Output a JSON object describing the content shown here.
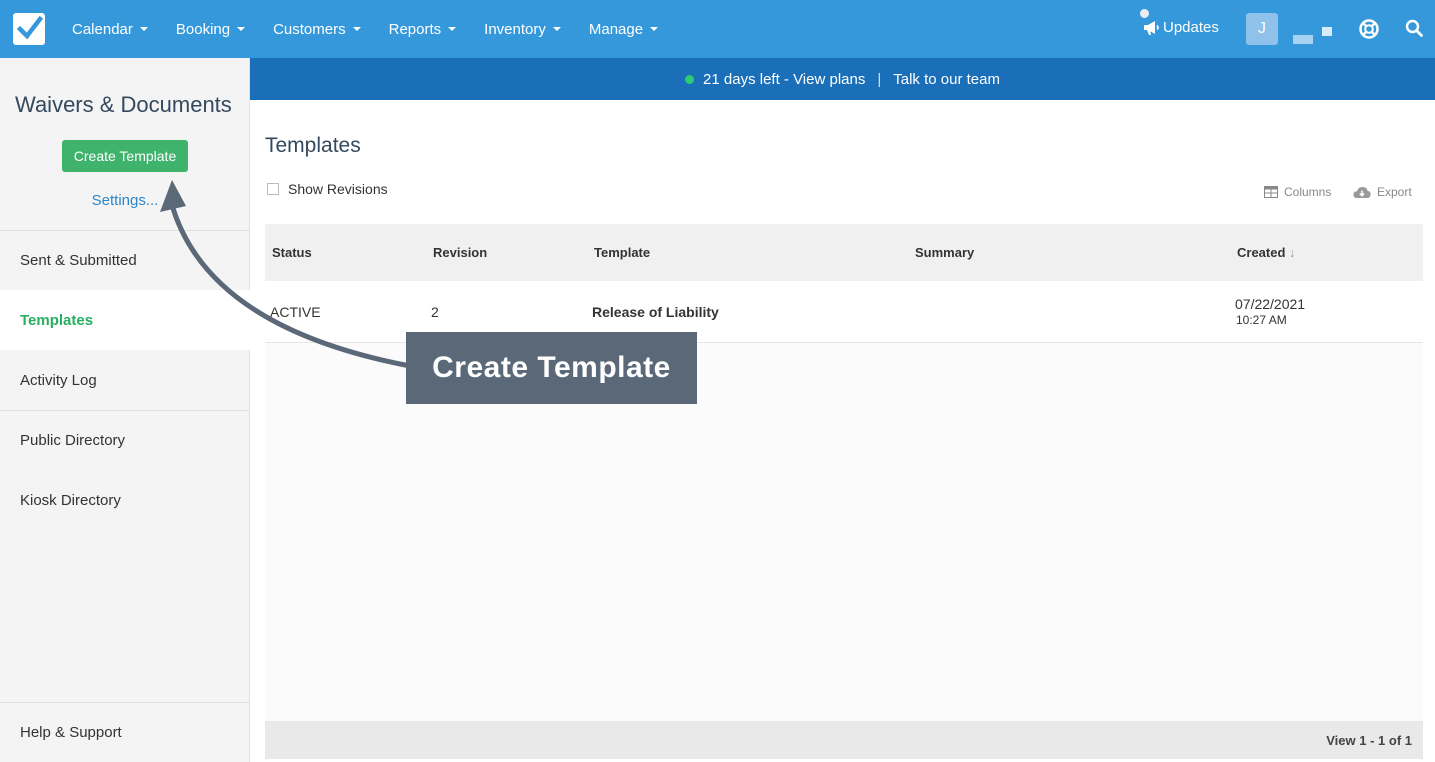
{
  "topnav": {
    "logo_icon": "checkbox-logo-icon",
    "items": [
      {
        "label": "Calendar"
      },
      {
        "label": "Booking"
      },
      {
        "label": "Customers"
      },
      {
        "label": "Reports"
      },
      {
        "label": "Inventory"
      },
      {
        "label": "Manage"
      }
    ],
    "updates_label": "Updates",
    "avatar_initial": "J"
  },
  "banner": {
    "trial_text": "21 days left - View plans",
    "separator": "|",
    "talk_text": "Talk to our team"
  },
  "sidebar": {
    "title": "Waivers & Documents",
    "create_button": "Create Template",
    "settings_link": "Settings...",
    "items": [
      {
        "label": "Sent & Submitted"
      },
      {
        "label": "Templates"
      },
      {
        "label": "Activity Log"
      },
      {
        "label": "Public Directory"
      },
      {
        "label": "Kiosk Directory"
      }
    ],
    "help": "Help & Support"
  },
  "main": {
    "title": "Templates",
    "show_revisions": "Show Revisions",
    "columns_label": "Columns",
    "export_label": "Export",
    "table": {
      "headers": [
        "Status",
        "Revision",
        "Template",
        "Summary",
        "Created"
      ],
      "sort_indicator": "↓",
      "rows": [
        {
          "status": "ACTIVE",
          "revision": "2",
          "template": "Release of Liability",
          "summary": "",
          "created_date": "07/22/2021",
          "created_time": "10:27 AM"
        }
      ]
    },
    "pager": "View 1 - 1 of 1"
  },
  "callout": {
    "text": "Create Template"
  },
  "colors": {
    "nav_bg": "#3498db",
    "banner_bg": "#1a6fb8",
    "button_green": "#3fb36b",
    "active_green": "#27ae60",
    "callout_bg": "#5a6878"
  }
}
